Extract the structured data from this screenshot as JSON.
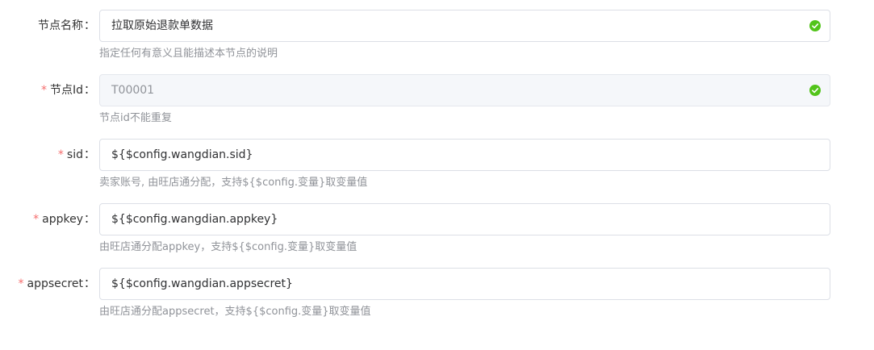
{
  "fields": [
    {
      "label": "节点名称",
      "required": false,
      "value": "拉取原始退款单数据",
      "help": "指定任何有意义且能描述本节点的说明",
      "valid": true,
      "disabled": false
    },
    {
      "label": "节点Id",
      "required": true,
      "value": "T00001",
      "help": "节点id不能重复",
      "valid": true,
      "disabled": true
    },
    {
      "label": "sid",
      "required": true,
      "value": "${$config.wangdian.sid}",
      "help": "卖家账号, 由旺店通分配，支持${$config.变量}取变量值",
      "valid": false,
      "disabled": false
    },
    {
      "label": "appkey",
      "required": true,
      "value": "${$config.wangdian.appkey}",
      "help": "由旺店通分配appkey，支持${$config.变量}取变量值",
      "valid": false,
      "disabled": false
    },
    {
      "label": "appsecret",
      "required": true,
      "value": "${$config.wangdian.appsecret}",
      "help": "由旺店通分配appsecret，支持${$config.变量}取变量值",
      "valid": false,
      "disabled": false
    }
  ],
  "colon": "：",
  "required_mark": "*",
  "icons": {
    "valid": "check-circle-icon"
  },
  "colors": {
    "required": "#f56c6c",
    "valid": "#52c41a",
    "help_text": "#909399",
    "border": "#dcdfe6",
    "disabled_bg": "#f5f7fa"
  }
}
